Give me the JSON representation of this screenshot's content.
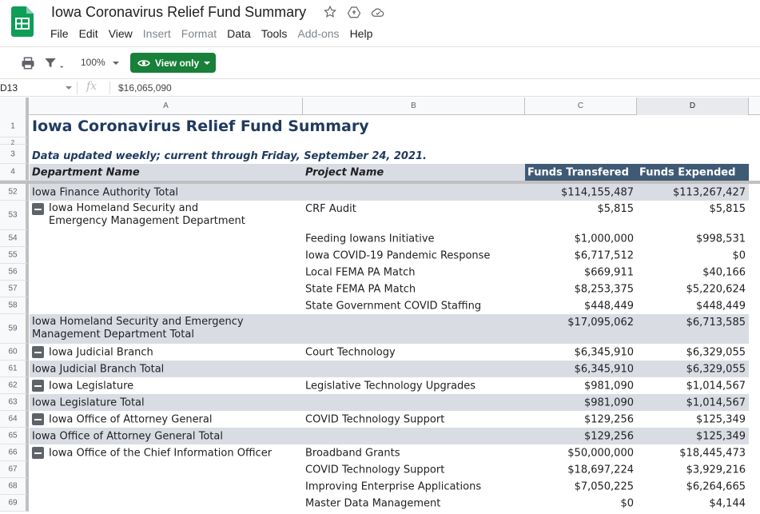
{
  "app": {
    "doc_title": "Iowa Coronavirus Relief Fund Summary",
    "menu": [
      {
        "label": "File",
        "disabled": false
      },
      {
        "label": "Edit",
        "disabled": false
      },
      {
        "label": "View",
        "disabled": false
      },
      {
        "label": "Insert",
        "disabled": true
      },
      {
        "label": "Format",
        "disabled": true
      },
      {
        "label": "Data",
        "disabled": false
      },
      {
        "label": "Tools",
        "disabled": false
      },
      {
        "label": "Add-ons",
        "disabled": true
      },
      {
        "label": "Help",
        "disabled": false
      }
    ]
  },
  "toolbar": {
    "zoom": "100%",
    "view_only_label": "View only"
  },
  "formula_bar": {
    "cell_ref": "D13",
    "fx": "fx",
    "value": "$16,065,090"
  },
  "columns": [
    "A",
    "B",
    "C",
    "D"
  ],
  "sheet": {
    "title": "Iowa Coronavirus Relief Fund Summary",
    "subtitle": "Data updated weekly; current through Friday, September 24, 2021.",
    "headers": {
      "department": "Department Name",
      "project": "Project Name",
      "transferred": "Funds Transfered",
      "expended": "Funds Expended"
    },
    "rows": [
      {
        "num": "52",
        "a": "Iowa Finance Authority Total",
        "b": "",
        "c": "$114,155,487",
        "d": "$113,267,427",
        "total": true,
        "group": false
      },
      {
        "num": "53",
        "a": "Iowa Homeland Security and Emergency Management Department",
        "b": "CRF Audit",
        "c": "$5,815",
        "d": "$5,815",
        "total": false,
        "group": true
      },
      {
        "num": "54",
        "a": "",
        "b": "Feeding Iowans Initiative",
        "c": "$1,000,000",
        "d": "$998,531",
        "total": false,
        "group": false
      },
      {
        "num": "55",
        "a": "",
        "b": "Iowa COVID-19 Pandemic Response",
        "c": "$6,717,512",
        "d": "$0",
        "total": false,
        "group": false
      },
      {
        "num": "56",
        "a": "",
        "b": "Local FEMA PA Match",
        "c": "$669,911",
        "d": "$40,166",
        "total": false,
        "group": false
      },
      {
        "num": "57",
        "a": "",
        "b": "State FEMA PA Match",
        "c": "$8,253,375",
        "d": "$5,220,624",
        "total": false,
        "group": false
      },
      {
        "num": "58",
        "a": "",
        "b": "State Government COVID Staffing",
        "c": "$448,449",
        "d": "$448,449",
        "total": false,
        "group": false
      },
      {
        "num": "59",
        "a": "Iowa Homeland Security and Emergency Management Department Total",
        "b": "",
        "c": "$17,095,062",
        "d": "$6,713,585",
        "total": true,
        "group": false
      },
      {
        "num": "60",
        "a": "Iowa Judicial Branch",
        "b": "Court Technology",
        "c": "$6,345,910",
        "d": "$6,329,055",
        "total": false,
        "group": true
      },
      {
        "num": "61",
        "a": "Iowa Judicial Branch Total",
        "b": "",
        "c": "$6,345,910",
        "d": "$6,329,055",
        "total": true,
        "group": false
      },
      {
        "num": "62",
        "a": "Iowa Legislature",
        "b": "Legislative Technology Upgrades",
        "c": "$981,090",
        "d": "$1,014,567",
        "total": false,
        "group": true
      },
      {
        "num": "63",
        "a": "Iowa Legislature Total",
        "b": "",
        "c": "$981,090",
        "d": "$1,014,567",
        "total": true,
        "group": false
      },
      {
        "num": "64",
        "a": "Iowa Office of Attorney General",
        "b": "COVID Technology Support",
        "c": "$129,256",
        "d": "$125,349",
        "total": false,
        "group": true
      },
      {
        "num": "65",
        "a": "Iowa Office of Attorney General  Total",
        "b": "",
        "c": "$129,256",
        "d": "$125,349",
        "total": true,
        "group": false
      },
      {
        "num": "66",
        "a": "Iowa Office of the Chief Information Officer",
        "b": "Broadband Grants",
        "c": "$50,000,000",
        "d": "$18,445,473",
        "total": false,
        "group": true
      },
      {
        "num": "67",
        "a": "",
        "b": "COVID Technology Support",
        "c": "$18,697,224",
        "d": "$3,929,216",
        "total": false,
        "group": false
      },
      {
        "num": "68",
        "a": "",
        "b": "Improving Enterprise Applications",
        "c": "$7,050,225",
        "d": "$6,264,665",
        "total": false,
        "group": false
      },
      {
        "num": "69",
        "a": "",
        "b": "Master Data Management",
        "c": "$0",
        "d": "$4,144",
        "total": false,
        "group": false
      }
    ],
    "row_numbers_top": [
      "1",
      "2",
      "3",
      "4"
    ]
  },
  "colors": {
    "header_dark": "#3f5a74",
    "total_shade": "#d9dde3",
    "title_blue": "#1f3a5f",
    "view_only_green": "#188038"
  }
}
